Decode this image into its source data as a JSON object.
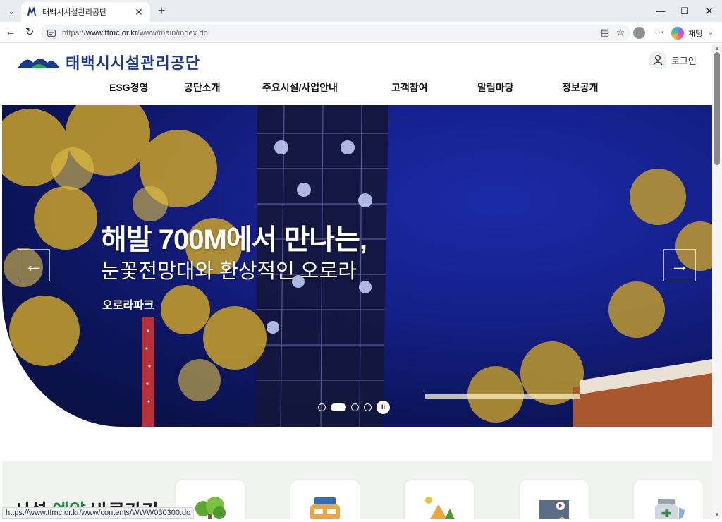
{
  "browser": {
    "tab": {
      "title": "태백시시설관리공단"
    },
    "url": {
      "scheme": "https://",
      "host": "www.tfmc.or.kr",
      "path": "/www/main/index.do"
    },
    "copilot_label": "채팅",
    "status_url": "https://www.tfmc.or.kr/www/contents/WWW030300.do"
  },
  "site": {
    "name": "태백시시설관리공단",
    "login_label": "로그인",
    "brand_color": "#1d3a8a",
    "nav": [
      "ESG경영",
      "공단소개",
      "주요시설/사업안내",
      "고객참여",
      "알림마당",
      "정보공개"
    ]
  },
  "hero": {
    "headline": "해발 700M에서 만나는,",
    "subline": "눈꽃전망대와 환상적인 오로라",
    "place": "오로라파크",
    "prev": "←",
    "next": "→",
    "pause": "II",
    "slides_total": 4,
    "active_slide": 2
  },
  "section": {
    "title_prefix": "시설",
    "title_highlight": "예약",
    "title_suffix": "바로가기",
    "highlight_color": "#1f8a3c"
  },
  "icons": [
    "tree-icon",
    "camper-icon",
    "camping-icon",
    "video-icon",
    "medicine-icon"
  ]
}
